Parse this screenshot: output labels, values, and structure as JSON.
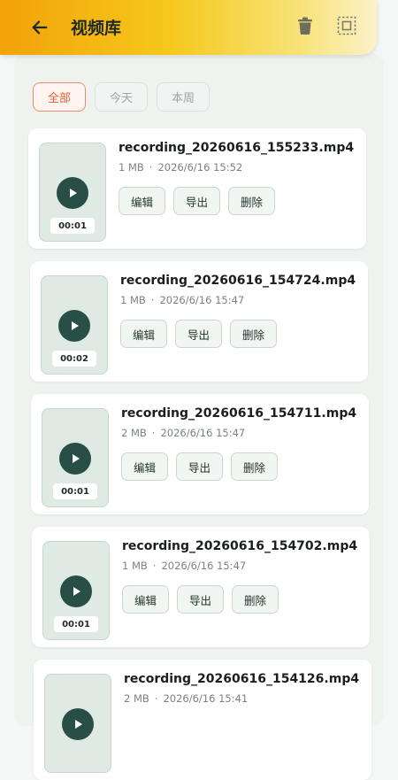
{
  "header": {
    "title": "视频库",
    "back_icon": "arrow-left-icon",
    "delete_icon": "trash-icon",
    "select_icon": "select-all-icon"
  },
  "filters": [
    {
      "label": "全部",
      "active": true
    },
    {
      "label": "今天",
      "active": false
    },
    {
      "label": "本周",
      "active": false
    }
  ],
  "videos": [
    {
      "filename": "recording_20260616_155233.mp4",
      "size": "1 MB",
      "date": "2026/6/16 15:52",
      "duration": "00:01"
    },
    {
      "filename": "recording_20260616_154724.mp4",
      "size": "1 MB",
      "date": "2026/6/16 15:47",
      "duration": "00:02"
    },
    {
      "filename": "recording_20260616_154711.mp4",
      "size": "2 MB",
      "date": "2026/6/16 15:47",
      "duration": "00:01"
    },
    {
      "filename": "recording_20260616_154702.mp4",
      "size": "1 MB",
      "date": "2026/6/16 15:47",
      "duration": "00:01"
    },
    {
      "filename": "recording_20260616_154126.mp4",
      "size": "2 MB",
      "date": "2026/6/16 15:41",
      "duration": ""
    }
  ],
  "actions": {
    "edit": "编辑",
    "export": "导出",
    "delete": "删除"
  },
  "separator": "·",
  "colors": {
    "accent": "#f2a20a",
    "play": "#284e45",
    "active_chip": "#e2603a"
  }
}
